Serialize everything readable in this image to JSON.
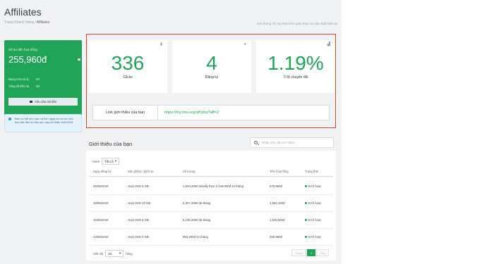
{
  "header": {
    "title": "Affiliates",
    "breadcrumb": {
      "home": "Trang Khách Hàng",
      "sep": "/",
      "current": "Affiliates"
    },
    "realtime_note": "Các thông số này theo thời gian thực và cập nhật hiện tại"
  },
  "balance": {
    "label": "Số dư tiền hoa hồng",
    "value": "255,960đ",
    "pending_label": "Đang chờ xử lý",
    "pending_value": "0đ",
    "withdrawn_label": "Tổng số tiền rút",
    "withdrawn_value": "0đ",
    "withdraw_button": "Yêu cầu rút tiền"
  },
  "info": "Bạn có thể yêu cầu rút tiền ngay khi số dư của bạn đạt đến số tiền yêu cầu tối thiểu 500,000đ",
  "stats": [
    {
      "value": "336",
      "label": "Clicks",
      "icon": "bookmark-icon"
    },
    {
      "value": "4",
      "label": "Đăng ký",
      "icon": "user-icon"
    },
    {
      "value": "1.19%",
      "label": "Tỉ lệ chuyển đổi",
      "icon": "bar-chart-icon"
    }
  ],
  "link": {
    "label": "Link giới thiệu của bạn",
    "url": "https://my.tino.org/aff.php?aff=2"
  },
  "referrals": {
    "title": "Giới thiệu của bạn",
    "search_placeholder": "Nhập yêu cầu tìm kiếm...",
    "show_label": "Xem",
    "show_value": "Tất cả",
    "columns": [
      "Ngày đăng ký",
      "Sản phẩm / Dịch vụ",
      "Số lượng",
      "Tiền hoa hồng",
      "Trạng thái"
    ],
    "rows": [
      {
        "date": "29/05/2019",
        "product": "Host SSD 6 GB",
        "amount": "1,933,200đ Initially then 2.148.000đ 12 tháng",
        "commission": "579,960đ",
        "status": "Kích hoạt"
      },
      {
        "date": "18/05/2019",
        "product": "Host SSD 10 GB",
        "amount": "5,307,200đ 36 tháng",
        "commission": "1,592,160đ",
        "status": "Kích hoạt"
      },
      {
        "date": "15/05/2019",
        "product": "Host SSD 8 GB",
        "amount": "5,155,200đ 36 tháng",
        "commission": "1,546,560đ",
        "status": "Kích hoạt"
      },
      {
        "date": "13/05/2019",
        "product": "Host SSD 2 GB",
        "amount": "853,200đ 12 tháng",
        "commission": "255,960đ",
        "status": "Kích hoạt"
      }
    ],
    "footer_show_label": "Hiển thị",
    "footer_page_size": "10",
    "footer_unit": "hàng",
    "pager": {
      "prev": "Trước",
      "page": "1",
      "next": "Tiếp"
    }
  },
  "colors": {
    "brand_green": "#20a558",
    "highlight_red": "#e0412c"
  }
}
